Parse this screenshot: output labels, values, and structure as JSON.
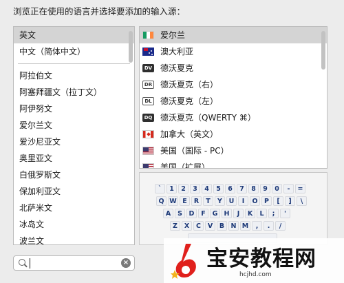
{
  "header": {
    "title": "浏览正在使用的语言并选择要添加的输入源："
  },
  "languages": {
    "pinned": [
      {
        "label": "英文",
        "selected": true
      },
      {
        "label": "中文（简体中文）",
        "selected": false
      }
    ],
    "items": [
      "阿拉伯文",
      "阿塞拜疆文（拉丁文）",
      "阿伊努文",
      "爱尔兰文",
      "爱沙尼亚文",
      "奥里亚文",
      "白俄罗斯文",
      "保加利亚文",
      "北萨米文",
      "冰岛文",
      "波兰文"
    ]
  },
  "sources": [
    {
      "label": "爱尔兰",
      "icon": "ireland-flag-icon",
      "icon_text": "",
      "selected": true
    },
    {
      "label": "澳大利亚",
      "icon": "australia-flag-icon",
      "icon_text": "",
      "selected": false
    },
    {
      "label": "德沃夏克",
      "icon": "dvorak-badge-icon",
      "icon_text": "DV",
      "selected": false
    },
    {
      "label": "德沃夏克（右）",
      "icon": "dvorak-right-badge-icon",
      "icon_text": "DR",
      "selected": false
    },
    {
      "label": "德沃夏克（左）",
      "icon": "dvorak-left-badge-icon",
      "icon_text": "DL",
      "selected": false
    },
    {
      "label": "德沃夏克（QWERTY ⌘）",
      "icon": "dvorak-qwerty-badge-icon",
      "icon_text": "DQ",
      "selected": false
    },
    {
      "label": "加拿大（英文）",
      "icon": "canada-flag-icon",
      "icon_text": "",
      "selected": false
    },
    {
      "label": "美国（国际 - PC）",
      "icon": "us-flag-icon",
      "icon_text": "",
      "selected": false
    },
    {
      "label": "美国（扩展）",
      "icon": "us-flag-icon",
      "icon_text": "",
      "selected": false
    }
  ],
  "keyboard": {
    "rows": [
      [
        "`",
        "1",
        "2",
        "3",
        "4",
        "5",
        "6",
        "7",
        "8",
        "9",
        "0",
        "-",
        "="
      ],
      [
        "Q",
        "W",
        "E",
        "R",
        "T",
        "Y",
        "U",
        "I",
        "O",
        "P",
        "[",
        "]",
        "\\"
      ],
      [
        "A",
        "S",
        "D",
        "F",
        "G",
        "H",
        "J",
        "K",
        "L",
        ";",
        "'"
      ],
      [
        "Z",
        "X",
        "C",
        "V",
        "B",
        "N",
        "M",
        ",",
        ".",
        "/"
      ]
    ]
  },
  "search": {
    "value": "",
    "placeholder": ""
  },
  "watermark": {
    "text": "宝安教程网",
    "domain": "hcjhd.com"
  },
  "colors": {
    "selection": "#d4d4d4",
    "key_text": "#1e3a78",
    "watermark_red": "#e0201c"
  }
}
